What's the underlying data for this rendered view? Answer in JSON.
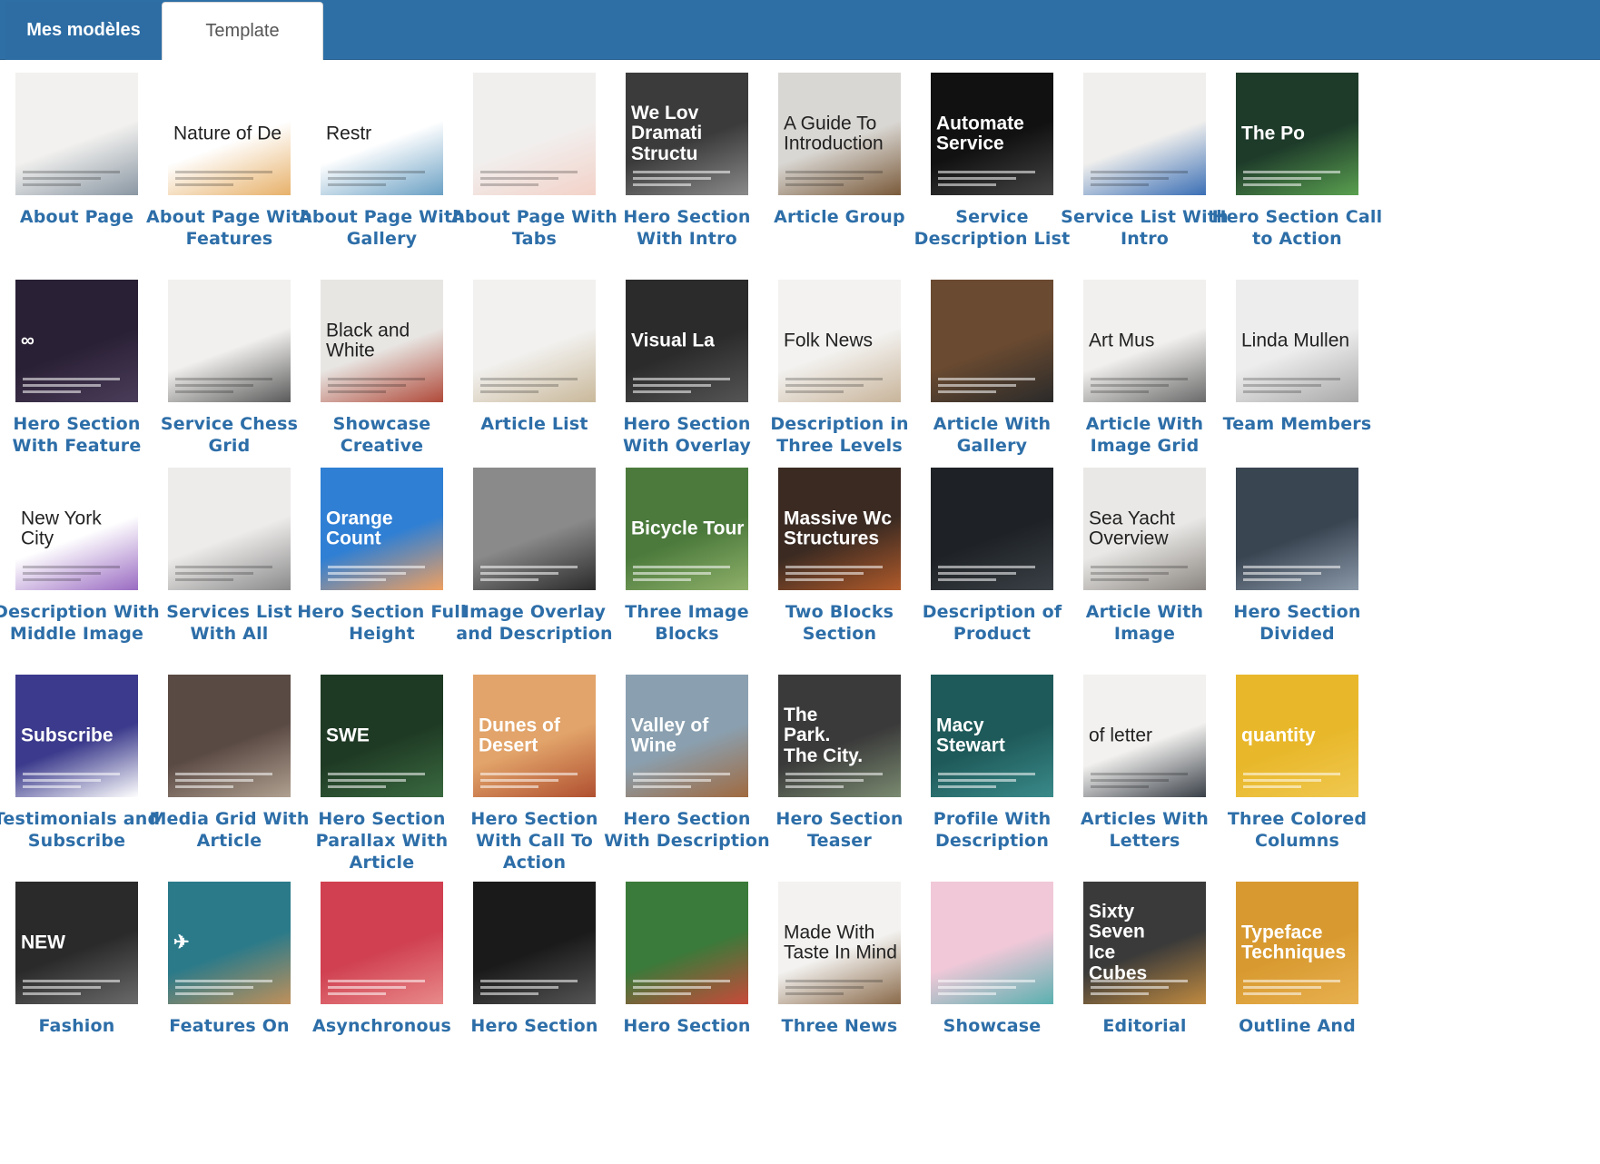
{
  "tabs": [
    {
      "label": "Mes modèles",
      "active": true
    },
    {
      "label": "Template library",
      "active": false
    }
  ],
  "templates": [
    {
      "title": "About Page",
      "thumb_text": "",
      "bg": "#f2f1ef",
      "accent": "#8a97a3",
      "dark": true
    },
    {
      "title": "About Page With Features",
      "thumb_text": "Nature of De",
      "bg": "#ffffff",
      "accent": "#e7b16a",
      "dark": true
    },
    {
      "title": "About Page With Gallery",
      "thumb_text": "Restr",
      "bg": "#ffffff",
      "accent": "#6aa0c4",
      "dark": true
    },
    {
      "title": "About Page With Tabs",
      "thumb_text": "",
      "bg": "#f1efee",
      "accent": "#f3d2c8",
      "dark": true
    },
    {
      "title": "Hero Section With Intro",
      "thumb_text": "We Lov\nDramati\nStructu",
      "bg": "#3b3b3b",
      "accent": "#8a8a8a",
      "dark": false
    },
    {
      "title": "Article Group",
      "thumb_text": "A Guide To\nIntroduction",
      "bg": "#d9d7d3",
      "accent": "#7a5a3a",
      "dark": true
    },
    {
      "title": "Service Description List",
      "thumb_text": "Automate\nService",
      "bg": "#111111",
      "accent": "#444444",
      "dark": false
    },
    {
      "title": "Service List With Intro",
      "thumb_text": "",
      "bg": "#f0efed",
      "accent": "#3b6fb5",
      "dark": true
    },
    {
      "title": "Hero Section Call to Action",
      "thumb_text": "The Po",
      "bg": "#1e3b2a",
      "accent": "#5aa050",
      "dark": false
    },
    {
      "title": "Hero Section With Feature",
      "thumb_text": "∞",
      "bg": "#2a2035",
      "accent": "#4a3d5a",
      "dark": false
    },
    {
      "title": "Service Chess Grid",
      "thumb_text": "",
      "bg": "#f1f0ee",
      "accent": "#5a5a5a",
      "dark": true
    },
    {
      "title": "Showcase Creative",
      "thumb_text": "Black and\nWhite",
      "bg": "#e8e6e3",
      "accent": "#b04a3a",
      "dark": true
    },
    {
      "title": "Article List",
      "thumb_text": "",
      "bg": "#f2f1ef",
      "accent": "#c9b89a",
      "dark": true
    },
    {
      "title": "Hero Section With Overlay",
      "thumb_text": "Visual La",
      "bg": "#2b2b2b",
      "accent": "#555555",
      "dark": false
    },
    {
      "title": "Description in Three Levels",
      "thumb_text": "Folk News",
      "bg": "#f3f2f0",
      "accent": "#c8b49a",
      "dark": true
    },
    {
      "title": "Article With Gallery",
      "thumb_text": "",
      "bg": "#6a4a30",
      "accent": "#2a2a2a",
      "dark": false
    },
    {
      "title": "Article With Image Grid",
      "thumb_text": "Art Mus",
      "bg": "#f1f0ee",
      "accent": "#6a6a6a",
      "dark": true
    },
    {
      "title": "Team Members",
      "thumb_text": "Linda Mullen",
      "bg": "#ededed",
      "accent": "#a8a8a8",
      "dark": true
    },
    {
      "title": "Description With Middle Image",
      "thumb_text": "New York\nCity",
      "bg": "#ffffff",
      "accent": "#9a6bc2",
      "dark": true
    },
    {
      "title": "Services List With All",
      "thumb_text": "",
      "bg": "#eeeceb",
      "accent": "#8a8a8a",
      "dark": true
    },
    {
      "title": "Hero Section Full Height",
      "thumb_text": "Orange Count",
      "bg": "#2f7fd4",
      "accent": "#f0a060",
      "dark": false
    },
    {
      "title": "Image Overlay and Description",
      "thumb_text": "",
      "bg": "#8a8a8a",
      "accent": "#2a2a2a",
      "dark": false
    },
    {
      "title": "Three Image Blocks",
      "thumb_text": "Bicycle Tour",
      "bg": "#4b7a3c",
      "accent": "#8fb06a",
      "dark": false
    },
    {
      "title": "Two Blocks Section",
      "thumb_text": "Massive Wc\nStructures",
      "bg": "#3a2a22",
      "accent": "#b05a2a",
      "dark": false
    },
    {
      "title": "Description of Product",
      "thumb_text": "",
      "bg": "#1e2226",
      "accent": "#3a4046",
      "dark": false
    },
    {
      "title": "Article With Image",
      "thumb_text": "Sea Yacht\nOverview",
      "bg": "#e9e8e6",
      "accent": "#8a8580",
      "dark": true
    },
    {
      "title": "Hero Section Divided",
      "thumb_text": "",
      "bg": "#3a4552",
      "accent": "#8a98a8",
      "dark": false
    },
    {
      "title": "Testimonials and Subscribe",
      "thumb_text": "Subscribe",
      "bg": "#3b3a8c",
      "accent": "#ffffff",
      "dark": false
    },
    {
      "title": "Media Grid With Article",
      "thumb_text": "",
      "bg": "#5a4a44",
      "accent": "#b0a090",
      "dark": false
    },
    {
      "title": "Hero Section Parallax With Article",
      "thumb_text": "SWE",
      "bg": "#1f3a24",
      "accent": "#3a6a40",
      "dark": false
    },
    {
      "title": "Hero Section With Call To Action",
      "thumb_text": "Dunes of\nDesert",
      "bg": "#e2a46a",
      "accent": "#b05030",
      "dark": false
    },
    {
      "title": "Hero Section With Description",
      "thumb_text": "Valley of Wine",
      "bg": "#8aa0b0",
      "accent": "#a06a40",
      "dark": false
    },
    {
      "title": "Hero Section Teaser",
      "thumb_text": "The\nPark.\nThe City.",
      "bg": "#3a3a3a",
      "accent": "#7a8a70",
      "dark": false
    },
    {
      "title": "Profile With Description",
      "thumb_text": "Macy Stewart",
      "bg": "#1f5a5a",
      "accent": "#3a8a8a",
      "dark": false
    },
    {
      "title": "Articles With Letters",
      "thumb_text": "of letter",
      "bg": "#f2f1ef",
      "accent": "#3a4048",
      "dark": true
    },
    {
      "title": "Three Colored Columns",
      "thumb_text": "quantity",
      "bg": "#e8b72a",
      "accent": "#f0c850",
      "dark": false
    },
    {
      "title": "Fashion",
      "thumb_text": "NEW",
      "bg": "#2a2a2a",
      "accent": "#6a6a6a",
      "dark": false
    },
    {
      "title": "Features On",
      "thumb_text": "✈",
      "bg": "#2a7a8a",
      "accent": "#c0905a",
      "dark": false
    },
    {
      "title": "Asynchronous",
      "thumb_text": "",
      "bg": "#d04050",
      "accent": "#e88a8a",
      "dark": false
    },
    {
      "title": "Hero Section",
      "thumb_text": "",
      "bg": "#1a1a1a",
      "accent": "#555555",
      "dark": false
    },
    {
      "title": "Hero Section",
      "thumb_text": "",
      "bg": "#3a7a3a",
      "accent": "#c84a3a",
      "dark": false
    },
    {
      "title": "Three News",
      "thumb_text": "Made With\nTaste In Mind",
      "bg": "#f3f2f0",
      "accent": "#8a6a4a",
      "dark": true
    },
    {
      "title": "Showcase",
      "thumb_text": "",
      "bg": "#f0c8d8",
      "accent": "#5ab0b0",
      "dark": false
    },
    {
      "title": "Editorial",
      "thumb_text": "Sixty\nSeven\nIce\nCubes",
      "bg": "#3a3a3a",
      "accent": "#c08a40",
      "dark": false
    },
    {
      "title": "Outline And",
      "thumb_text": "Typeface\nTechniques",
      "bg": "#d89a30",
      "accent": "#e8b050",
      "dark": false
    }
  ]
}
